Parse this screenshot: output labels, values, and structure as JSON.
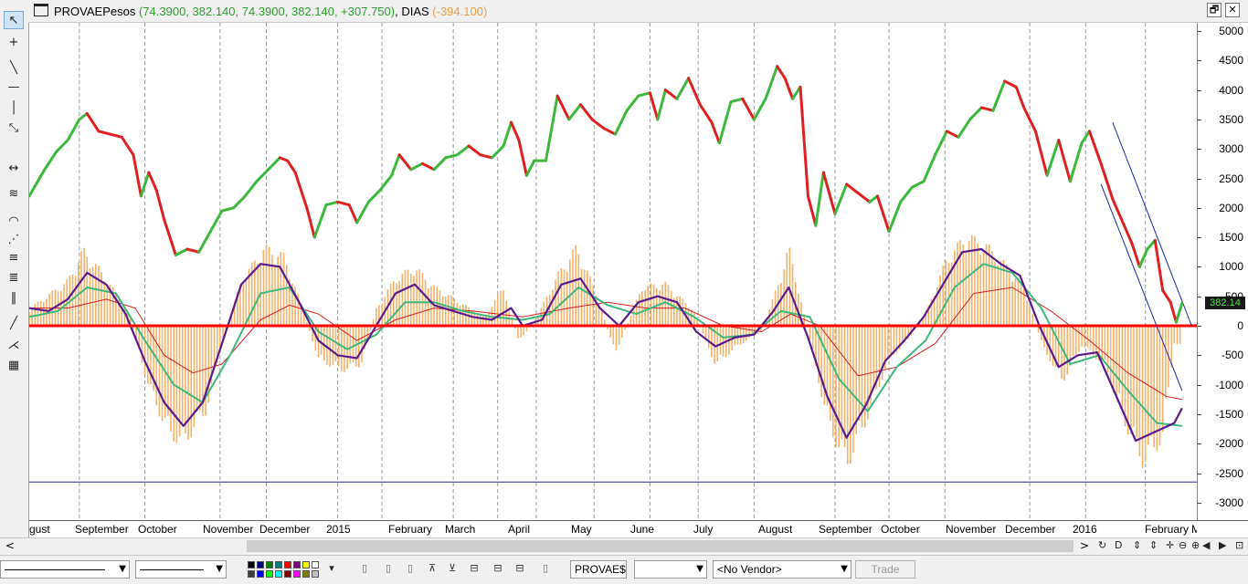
{
  "window": {
    "symbol": "PROVAEPesos",
    "ohlc_text": "(74.3900, 382.140, 74.3900, 382.140, +307.750)",
    "indicator": "DIAS",
    "indicator_value": "(-394.100)",
    "restore_glyph": "🗗",
    "close_glyph": "✕"
  },
  "tools": [
    {
      "name": "pointer-tool-icon",
      "glyph": "↖"
    },
    {
      "name": "crosshair-tool-icon",
      "glyph": "+"
    },
    {
      "name": "trendline-tool-icon",
      "glyph": "╲"
    },
    {
      "name": "horizontal-line-tool-icon",
      "glyph": "—"
    },
    {
      "name": "vertical-line-tool-icon",
      "glyph": "│"
    },
    {
      "name": "measure-tool-icon",
      "glyph": "⤡"
    },
    {
      "name": "zoom-range-tool-icon",
      "glyph": "↔"
    },
    {
      "name": "flag-tool-icon",
      "glyph": "≋"
    },
    {
      "name": "arc-tool-icon",
      "glyph": "◠"
    },
    {
      "name": "pitchfork-tool-icon",
      "glyph": "⋰"
    },
    {
      "name": "fib-retracement-tool-icon",
      "glyph": "≡"
    },
    {
      "name": "fib-extension-tool-icon",
      "glyph": "≣"
    },
    {
      "name": "cycle-lines-tool-icon",
      "glyph": "‖"
    },
    {
      "name": "channel-tool-icon",
      "glyph": "╱"
    },
    {
      "name": "fan-tool-icon",
      "glyph": "⋌"
    },
    {
      "name": "grid-tool-icon",
      "glyph": "▦"
    }
  ],
  "chart_data": {
    "type": "line",
    "price_scale": {
      "min": -3000,
      "max": 5000,
      "ticks": [
        5000,
        4500,
        4000,
        3500,
        3000,
        2500,
        2000,
        1500,
        1000,
        500,
        0,
        -500,
        -1000,
        -1500,
        -2000,
        -2500,
        -3000
      ]
    },
    "last_price_label": "382.14",
    "x_labels": [
      "gust",
      "September",
      "October",
      "November",
      "December",
      "2015",
      "February",
      "March",
      "April",
      "May",
      "June",
      "July",
      "August",
      "September",
      "October",
      "November",
      "December",
      "2016",
      "February",
      "M"
    ],
    "price_series": [
      {
        "d": 0,
        "v": 2200
      },
      {
        "d": 8,
        "v": 2650
      },
      {
        "d": 14,
        "v": 2950
      },
      {
        "d": 20,
        "v": 3150
      },
      {
        "d": 26,
        "v": 3500
      },
      {
        "d": 30,
        "v": 3600
      },
      {
        "d": 36,
        "v": 3300
      },
      {
        "d": 42,
        "v": 3250
      },
      {
        "d": 48,
        "v": 3200
      },
      {
        "d": 54,
        "v": 2900
      },
      {
        "d": 58,
        "v": 2200
      },
      {
        "d": 62,
        "v": 2600
      },
      {
        "d": 66,
        "v": 2300
      },
      {
        "d": 70,
        "v": 1800
      },
      {
        "d": 76,
        "v": 1200
      },
      {
        "d": 82,
        "v": 1300
      },
      {
        "d": 88,
        "v": 1250
      },
      {
        "d": 94,
        "v": 1600
      },
      {
        "d": 100,
        "v": 1950
      },
      {
        "d": 106,
        "v": 2000
      },
      {
        "d": 112,
        "v": 2200
      },
      {
        "d": 118,
        "v": 2450
      },
      {
        "d": 124,
        "v": 2650
      },
      {
        "d": 130,
        "v": 2850
      },
      {
        "d": 134,
        "v": 2800
      },
      {
        "d": 138,
        "v": 2600
      },
      {
        "d": 144,
        "v": 2000
      },
      {
        "d": 148,
        "v": 1500
      },
      {
        "d": 154,
        "v": 2050
      },
      {
        "d": 160,
        "v": 2100
      },
      {
        "d": 166,
        "v": 2050
      },
      {
        "d": 170,
        "v": 1750
      },
      {
        "d": 176,
        "v": 2100
      },
      {
        "d": 182,
        "v": 2300
      },
      {
        "d": 188,
        "v": 2550
      },
      {
        "d": 192,
        "v": 2900
      },
      {
        "d": 198,
        "v": 2650
      },
      {
        "d": 204,
        "v": 2750
      },
      {
        "d": 210,
        "v": 2650
      },
      {
        "d": 216,
        "v": 2850
      },
      {
        "d": 222,
        "v": 2900
      },
      {
        "d": 228,
        "v": 3050
      },
      {
        "d": 234,
        "v": 2900
      },
      {
        "d": 240,
        "v": 2850
      },
      {
        "d": 246,
        "v": 3050
      },
      {
        "d": 250,
        "v": 3450
      },
      {
        "d": 254,
        "v": 3150
      },
      {
        "d": 258,
        "v": 2550
      },
      {
        "d": 262,
        "v": 2800
      },
      {
        "d": 268,
        "v": 2800
      },
      {
        "d": 274,
        "v": 3900
      },
      {
        "d": 280,
        "v": 3500
      },
      {
        "d": 286,
        "v": 3750
      },
      {
        "d": 292,
        "v": 3500
      },
      {
        "d": 298,
        "v": 3350
      },
      {
        "d": 304,
        "v": 3250
      },
      {
        "d": 310,
        "v": 3650
      },
      {
        "d": 316,
        "v": 3900
      },
      {
        "d": 322,
        "v": 3950
      },
      {
        "d": 326,
        "v": 3500
      },
      {
        "d": 330,
        "v": 4000
      },
      {
        "d": 336,
        "v": 3850
      },
      {
        "d": 342,
        "v": 4200
      },
      {
        "d": 348,
        "v": 3750
      },
      {
        "d": 354,
        "v": 3450
      },
      {
        "d": 358,
        "v": 3100
      },
      {
        "d": 364,
        "v": 3800
      },
      {
        "d": 370,
        "v": 3850
      },
      {
        "d": 376,
        "v": 3500
      },
      {
        "d": 382,
        "v": 3850
      },
      {
        "d": 388,
        "v": 4400
      },
      {
        "d": 392,
        "v": 4200
      },
      {
        "d": 396,
        "v": 3850
      },
      {
        "d": 400,
        "v": 4050
      },
      {
        "d": 404,
        "v": 2200
      },
      {
        "d": 408,
        "v": 1700
      },
      {
        "d": 412,
        "v": 2600
      },
      {
        "d": 418,
        "v": 1900
      },
      {
        "d": 424,
        "v": 2400
      },
      {
        "d": 430,
        "v": 2250
      },
      {
        "d": 436,
        "v": 2100
      },
      {
        "d": 440,
        "v": 2200
      },
      {
        "d": 446,
        "v": 1600
      },
      {
        "d": 452,
        "v": 2100
      },
      {
        "d": 458,
        "v": 2350
      },
      {
        "d": 464,
        "v": 2450
      },
      {
        "d": 470,
        "v": 2900
      },
      {
        "d": 476,
        "v": 3300
      },
      {
        "d": 482,
        "v": 3200
      },
      {
        "d": 488,
        "v": 3500
      },
      {
        "d": 494,
        "v": 3700
      },
      {
        "d": 500,
        "v": 3650
      },
      {
        "d": 506,
        "v": 4150
      },
      {
        "d": 512,
        "v": 4050
      },
      {
        "d": 516,
        "v": 3700
      },
      {
        "d": 522,
        "v": 3300
      },
      {
        "d": 528,
        "v": 2550
      },
      {
        "d": 534,
        "v": 3150
      },
      {
        "d": 540,
        "v": 2450
      },
      {
        "d": 546,
        "v": 3100
      },
      {
        "d": 550,
        "v": 3300
      },
      {
        "d": 556,
        "v": 2750
      },
      {
        "d": 562,
        "v": 2150
      },
      {
        "d": 568,
        "v": 1700
      },
      {
        "d": 572,
        "v": 1400
      },
      {
        "d": 576,
        "v": 1000
      },
      {
        "d": 580,
        "v": 1300
      },
      {
        "d": 584,
        "v": 1450
      },
      {
        "d": 588,
        "v": 600
      },
      {
        "d": 592,
        "v": 400
      },
      {
        "d": 595,
        "v": 60
      },
      {
        "d": 598,
        "v": 382
      }
    ],
    "oscillator_main": [
      {
        "d": 0,
        "v": 300
      },
      {
        "d": 10,
        "v": 250
      },
      {
        "d": 20,
        "v": 450
      },
      {
        "d": 30,
        "v": 900
      },
      {
        "d": 40,
        "v": 700
      },
      {
        "d": 50,
        "v": 200
      },
      {
        "d": 60,
        "v": -600
      },
      {
        "d": 70,
        "v": -1300
      },
      {
        "d": 80,
        "v": -1700
      },
      {
        "d": 90,
        "v": -1300
      },
      {
        "d": 100,
        "v": -300
      },
      {
        "d": 110,
        "v": 700
      },
      {
        "d": 120,
        "v": 1050
      },
      {
        "d": 130,
        "v": 1000
      },
      {
        "d": 140,
        "v": 400
      },
      {
        "d": 150,
        "v": -250
      },
      {
        "d": 160,
        "v": -500
      },
      {
        "d": 170,
        "v": -550
      },
      {
        "d": 180,
        "v": 0
      },
      {
        "d": 190,
        "v": 550
      },
      {
        "d": 200,
        "v": 700
      },
      {
        "d": 210,
        "v": 350
      },
      {
        "d": 220,
        "v": 250
      },
      {
        "d": 230,
        "v": 150
      },
      {
        "d": 240,
        "v": 100
      },
      {
        "d": 250,
        "v": 300
      },
      {
        "d": 256,
        "v": 0
      },
      {
        "d": 266,
        "v": 100
      },
      {
        "d": 276,
        "v": 700
      },
      {
        "d": 286,
        "v": 800
      },
      {
        "d": 296,
        "v": 300
      },
      {
        "d": 306,
        "v": 0
      },
      {
        "d": 316,
        "v": 400
      },
      {
        "d": 326,
        "v": 500
      },
      {
        "d": 336,
        "v": 400
      },
      {
        "d": 346,
        "v": -100
      },
      {
        "d": 356,
        "v": -350
      },
      {
        "d": 366,
        "v": -200
      },
      {
        "d": 376,
        "v": -150
      },
      {
        "d": 386,
        "v": 250
      },
      {
        "d": 394,
        "v": 650
      },
      {
        "d": 404,
        "v": -200
      },
      {
        "d": 414,
        "v": -1200
      },
      {
        "d": 424,
        "v": -1900
      },
      {
        "d": 434,
        "v": -1350
      },
      {
        "d": 444,
        "v": -600
      },
      {
        "d": 454,
        "v": -250
      },
      {
        "d": 464,
        "v": 150
      },
      {
        "d": 474,
        "v": 700
      },
      {
        "d": 484,
        "v": 1250
      },
      {
        "d": 494,
        "v": 1300
      },
      {
        "d": 504,
        "v": 1050
      },
      {
        "d": 514,
        "v": 850
      },
      {
        "d": 524,
        "v": 0
      },
      {
        "d": 534,
        "v": -700
      },
      {
        "d": 544,
        "v": -500
      },
      {
        "d": 554,
        "v": -450
      },
      {
        "d": 564,
        "v": -1200
      },
      {
        "d": 574,
        "v": -1950
      },
      {
        "d": 584,
        "v": -1800
      },
      {
        "d": 594,
        "v": -1650
      },
      {
        "d": 598,
        "v": -1400
      }
    ],
    "oscillator_signal": [
      {
        "d": 0,
        "v": 150
      },
      {
        "d": 15,
        "v": 250
      },
      {
        "d": 30,
        "v": 650
      },
      {
        "d": 45,
        "v": 550
      },
      {
        "d": 60,
        "v": -250
      },
      {
        "d": 75,
        "v": -1000
      },
      {
        "d": 90,
        "v": -1300
      },
      {
        "d": 105,
        "v": -450
      },
      {
        "d": 120,
        "v": 550
      },
      {
        "d": 135,
        "v": 650
      },
      {
        "d": 150,
        "v": -100
      },
      {
        "d": 165,
        "v": -400
      },
      {
        "d": 180,
        "v": -150
      },
      {
        "d": 195,
        "v": 400
      },
      {
        "d": 210,
        "v": 400
      },
      {
        "d": 225,
        "v": 250
      },
      {
        "d": 240,
        "v": 150
      },
      {
        "d": 256,
        "v": 100
      },
      {
        "d": 270,
        "v": 200
      },
      {
        "d": 285,
        "v": 650
      },
      {
        "d": 300,
        "v": 350
      },
      {
        "d": 315,
        "v": 200
      },
      {
        "d": 330,
        "v": 400
      },
      {
        "d": 345,
        "v": 150
      },
      {
        "d": 360,
        "v": -200
      },
      {
        "d": 375,
        "v": -150
      },
      {
        "d": 390,
        "v": 250
      },
      {
        "d": 405,
        "v": 150
      },
      {
        "d": 420,
        "v": -900
      },
      {
        "d": 435,
        "v": -1450
      },
      {
        "d": 450,
        "v": -700
      },
      {
        "d": 465,
        "v": -250
      },
      {
        "d": 480,
        "v": 650
      },
      {
        "d": 495,
        "v": 1050
      },
      {
        "d": 510,
        "v": 900
      },
      {
        "d": 525,
        "v": 300
      },
      {
        "d": 540,
        "v": -650
      },
      {
        "d": 555,
        "v": -500
      },
      {
        "d": 570,
        "v": -1100
      },
      {
        "d": 585,
        "v": -1650
      },
      {
        "d": 598,
        "v": -1700
      }
    ],
    "oscillator_slow": [
      {
        "d": 0,
        "v": 300
      },
      {
        "d": 20,
        "v": 300
      },
      {
        "d": 40,
        "v": 450
      },
      {
        "d": 55,
        "v": 300
      },
      {
        "d": 70,
        "v": -500
      },
      {
        "d": 85,
        "v": -800
      },
      {
        "d": 100,
        "v": -650
      },
      {
        "d": 120,
        "v": 100
      },
      {
        "d": 135,
        "v": 350
      },
      {
        "d": 150,
        "v": 200
      },
      {
        "d": 170,
        "v": -250
      },
      {
        "d": 190,
        "v": 100
      },
      {
        "d": 210,
        "v": 300
      },
      {
        "d": 230,
        "v": 250
      },
      {
        "d": 256,
        "v": 150
      },
      {
        "d": 280,
        "v": 300
      },
      {
        "d": 300,
        "v": 400
      },
      {
        "d": 320,
        "v": 300
      },
      {
        "d": 340,
        "v": 300
      },
      {
        "d": 360,
        "v": 0
      },
      {
        "d": 380,
        "v": -100
      },
      {
        "d": 395,
        "v": 200
      },
      {
        "d": 410,
        "v": 0
      },
      {
        "d": 430,
        "v": -850
      },
      {
        "d": 450,
        "v": -700
      },
      {
        "d": 470,
        "v": -300
      },
      {
        "d": 490,
        "v": 550
      },
      {
        "d": 510,
        "v": 650
      },
      {
        "d": 530,
        "v": 250
      },
      {
        "d": 550,
        "v": -250
      },
      {
        "d": 570,
        "v": -800
      },
      {
        "d": 590,
        "v": -1200
      },
      {
        "d": 598,
        "v": -1250
      }
    ],
    "histogram_envelope": [
      {
        "d": 0,
        "v": 300
      },
      {
        "d": 20,
        "v": 800
      },
      {
        "d": 28,
        "v": 1350
      },
      {
        "d": 40,
        "v": 850
      },
      {
        "d": 52,
        "v": 200
      },
      {
        "d": 62,
        "v": -1100
      },
      {
        "d": 72,
        "v": -1900
      },
      {
        "d": 80,
        "v": -2100
      },
      {
        "d": 92,
        "v": -1500
      },
      {
        "d": 100,
        "v": -300
      },
      {
        "d": 110,
        "v": 800
      },
      {
        "d": 122,
        "v": 1400
      },
      {
        "d": 132,
        "v": 1250
      },
      {
        "d": 142,
        "v": 300
      },
      {
        "d": 150,
        "v": -600
      },
      {
        "d": 162,
        "v": -800
      },
      {
        "d": 172,
        "v": -700
      },
      {
        "d": 180,
        "v": 300
      },
      {
        "d": 190,
        "v": 850
      },
      {
        "d": 200,
        "v": 1050
      },
      {
        "d": 210,
        "v": 700
      },
      {
        "d": 222,
        "v": 450
      },
      {
        "d": 236,
        "v": 150
      },
      {
        "d": 246,
        "v": 700
      },
      {
        "d": 254,
        "v": -300
      },
      {
        "d": 264,
        "v": 200
      },
      {
        "d": 274,
        "v": 900
      },
      {
        "d": 284,
        "v": 1400
      },
      {
        "d": 294,
        "v": 600
      },
      {
        "d": 304,
        "v": -500
      },
      {
        "d": 318,
        "v": 700
      },
      {
        "d": 330,
        "v": 750
      },
      {
        "d": 344,
        "v": 300
      },
      {
        "d": 356,
        "v": -700
      },
      {
        "d": 368,
        "v": -350
      },
      {
        "d": 380,
        "v": -100
      },
      {
        "d": 390,
        "v": 900
      },
      {
        "d": 394,
        "v": 1400
      },
      {
        "d": 404,
        "v": -100
      },
      {
        "d": 414,
        "v": -1700
      },
      {
        "d": 424,
        "v": -2500
      },
      {
        "d": 434,
        "v": -1700
      },
      {
        "d": 446,
        "v": -600
      },
      {
        "d": 456,
        "v": -250
      },
      {
        "d": 466,
        "v": 300
      },
      {
        "d": 476,
        "v": 1200
      },
      {
        "d": 486,
        "v": 1600
      },
      {
        "d": 496,
        "v": 1450
      },
      {
        "d": 506,
        "v": 1100
      },
      {
        "d": 516,
        "v": 700
      },
      {
        "d": 526,
        "v": -400
      },
      {
        "d": 536,
        "v": -1000
      },
      {
        "d": 546,
        "v": -350
      },
      {
        "d": 558,
        "v": -700
      },
      {
        "d": 568,
        "v": -1700
      },
      {
        "d": 578,
        "v": -2450
      },
      {
        "d": 588,
        "v": -2000
      },
      {
        "d": 594,
        "v": -300
      },
      {
        "d": 598,
        "v": -400
      }
    ],
    "zero_line": 0,
    "support_line": -2650,
    "channel": [
      {
        "d1": 556,
        "v1": 2400,
        "d2": 598,
        "v2": -1100
      },
      {
        "d1": 562,
        "v1": 3450,
        "d2": 603,
        "v2": 0
      }
    ],
    "vertical_gridlines_days": [
      26,
      60,
      99,
      123,
      160,
      183,
      220,
      243,
      263,
      293,
      322,
      347,
      376,
      418,
      446,
      475,
      519,
      548,
      579
    ]
  },
  "scrollbar": {
    "left_arrow": "<",
    "right_arrow": ">",
    "controls": [
      "↻",
      "D",
      "⇕",
      "⇕",
      "✛",
      "⊖",
      "⊕",
      "◀",
      "▶",
      "⊡"
    ]
  },
  "bottombar": {
    "symbol": "PROVAE$",
    "vendor": "<No Vendor>",
    "trade": "Trade",
    "swatch_colors": [
      "#000000",
      "#000080",
      "#008000",
      "#008080",
      "#ff0000",
      "#800080",
      "#ffff00",
      "#ffffff",
      "#404040",
      "#0000ff",
      "#00ff00",
      "#00ffff",
      "#800000",
      "#ff00ff",
      "#808000",
      "#c0c0c0"
    ]
  },
  "colors": {
    "up": "#3cb83c",
    "down": "#e02020",
    "histogram": "#f5b26b",
    "osc_main": "#5a1a8c",
    "osc_signal": "#3cb878",
    "osc_slow": "#d42020",
    "grid": "#9a9a9a",
    "zero": "#ff0000",
    "support": "#2b2b8c",
    "channel": "#1a2aa8"
  }
}
